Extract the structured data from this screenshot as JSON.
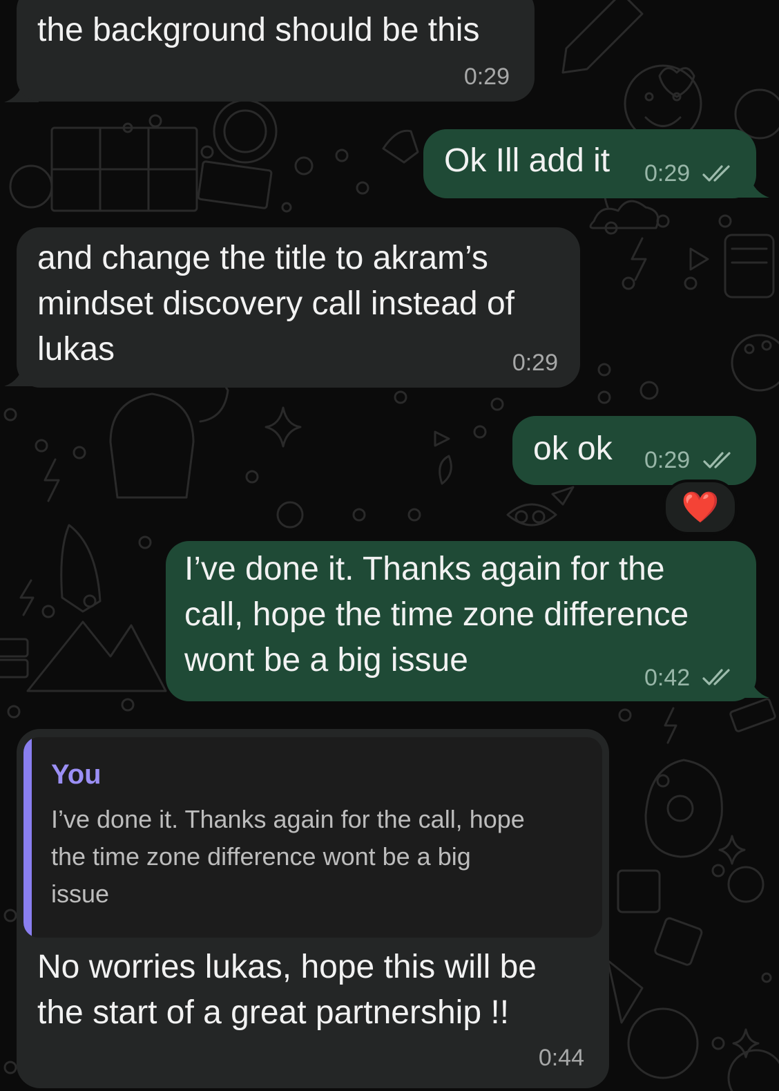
{
  "conversation": {
    "messages": [
      {
        "direction": "incoming",
        "text": "the background should be this",
        "time": "0:29"
      },
      {
        "direction": "outgoing",
        "text": "Ok Ill add it",
        "time": "0:29",
        "status": "double-check-icon"
      },
      {
        "direction": "incoming",
        "text": "and change the title to akram’s\nmindset discovery call instead of\nlukas",
        "time": "0:29"
      },
      {
        "direction": "outgoing",
        "text": "ok ok",
        "time": "0:29",
        "status": "double-check-icon",
        "reaction": "❤️"
      },
      {
        "direction": "outgoing",
        "text": "I’ve done it. Thanks again for the\ncall, hope the time zone difference\nwont be a big issue",
        "time": "0:42",
        "status": "double-check-icon"
      },
      {
        "direction": "incoming",
        "reply_to": {
          "author": "You",
          "text": "I’ve done it. Thanks again for the call, hope\nthe time zone difference wont be a big\nissue"
        },
        "text": "No worries lukas, hope this will be\nthe start of a great partnership !!",
        "time": "0:44"
      }
    ]
  },
  "colors": {
    "incoming_bubble": "#242626",
    "outgoing_bubble": "#1f4a36",
    "background": "#0b0b0b",
    "quote_accent": "#8a7ff0"
  }
}
